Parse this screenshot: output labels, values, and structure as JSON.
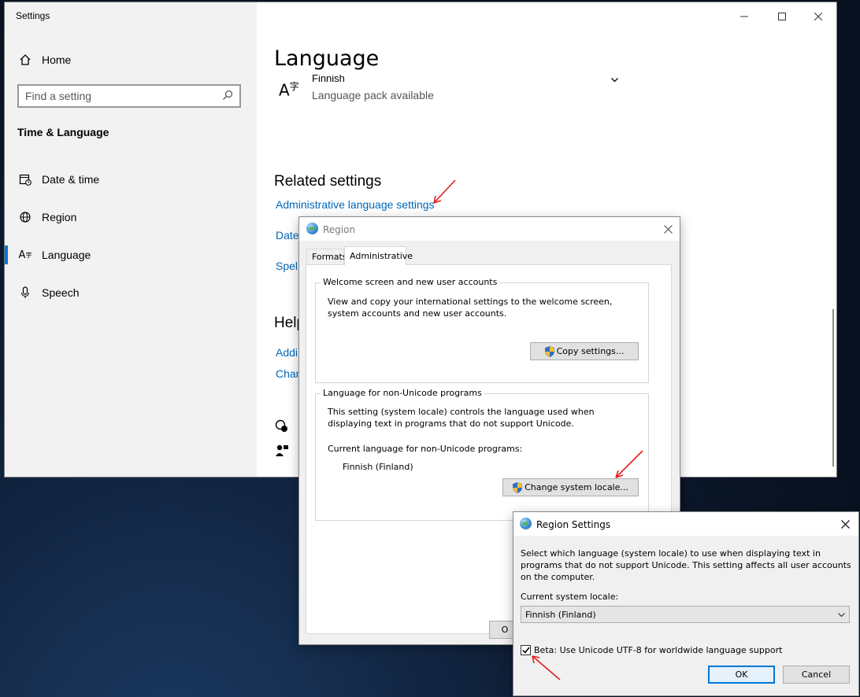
{
  "settings": {
    "window_title": "Settings",
    "nav": {
      "home": "Home",
      "search_placeholder": "Find a setting",
      "section": "Time & Language",
      "items": [
        {
          "label": "Date & time"
        },
        {
          "label": "Region"
        },
        {
          "label": "Language"
        },
        {
          "label": "Speech"
        }
      ],
      "active_item": "Language"
    },
    "main": {
      "page_title": "Language",
      "language_item": {
        "name": "Finnish",
        "status": "Language pack available"
      },
      "related_settings_heading": "Related settings",
      "related_links": [
        "Administrative language settings",
        "Date",
        "Spell"
      ],
      "help_heading": "Help",
      "help_links": [
        "Addi",
        "Chan"
      ]
    }
  },
  "region_dialog": {
    "title": "Region",
    "tabs": [
      {
        "label": "Formats"
      },
      {
        "label": "Administrative"
      }
    ],
    "active_tab": "Administrative",
    "welcome_group": {
      "label": "Welcome screen and new user accounts",
      "description": "View and copy your international settings to the welcome screen, system accounts and new user accounts.",
      "button": "Copy settings..."
    },
    "nonunicode_group": {
      "label": "Language for non-Unicode programs",
      "description": "This setting (system locale) controls the language used when displaying text in programs that do not support Unicode.",
      "current_label": "Current language for non-Unicode programs:",
      "current_value": "Finnish (Finland)",
      "button": "Change system locale..."
    },
    "footer_button_partial": "O"
  },
  "region_settings_dialog": {
    "title": "Region Settings",
    "description": "Select which language (system locale) to use when displaying text in programs that do not support Unicode. This setting affects all user accounts on the computer.",
    "current_locale_label": "Current system locale:",
    "current_locale_value": "Finnish (Finland)",
    "beta_checkbox": {
      "label": "Beta: Use Unicode UTF-8 for worldwide language support",
      "checked": true
    },
    "ok": "OK",
    "cancel": "Cancel"
  },
  "annotation_color": "#e02020"
}
